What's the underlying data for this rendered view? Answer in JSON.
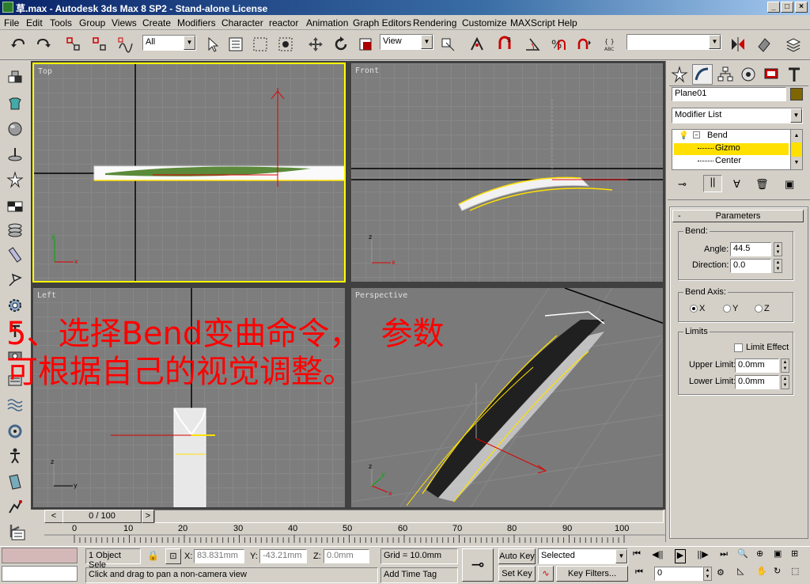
{
  "window": {
    "title": "草.max - Autodesk 3ds Max 8 SP2 - Stand-alone License",
    "min": "_",
    "max": "□",
    "close": "×"
  },
  "menu": [
    "File",
    "Edit",
    "Tools",
    "Group",
    "Views",
    "Create",
    "Modifiers",
    "Character",
    "reactor",
    "Animation",
    "Graph Editors",
    "Rendering",
    "Customize",
    "MAXScript",
    "Help"
  ],
  "toolbar": {
    "selection_filter": "All",
    "ref_coord": "View",
    "named_sel": ""
  },
  "viewports": {
    "top": "Top",
    "front": "Front",
    "left": "Left",
    "perspective": "Perspective",
    "axis_x": "x",
    "axis_y": "y",
    "axis_z": "z"
  },
  "overlay": {
    "line1": "5、选择Bend变曲命令，  参数",
    "line2": "可根据自己的视觉调整。"
  },
  "timeline": {
    "frame": "0 / 100",
    "prev": "<",
    "next": ">",
    "ticks": [
      "0",
      "10",
      "20",
      "30",
      "40",
      "50",
      "60",
      "70",
      "80",
      "90",
      "100"
    ]
  },
  "command_panel": {
    "object_name": "Plane01",
    "object_color": "#806600",
    "modifier_list": "Modifier List",
    "stack": [
      {
        "label": "Bend",
        "selected": false
      },
      {
        "label": "Gizmo",
        "selected": true
      },
      {
        "label": "Center",
        "selected": false
      }
    ],
    "rollout_title": "Parameters",
    "rollout_toggle": "-",
    "bend_group": "Bend:",
    "angle_label": "Angle:",
    "angle_value": "44.5",
    "direction_label": "Direction:",
    "direction_value": "0.0",
    "bend_axis_group": "Bend Axis:",
    "axis_x": "X",
    "axis_y": "Y",
    "axis_z": "Z",
    "selected_axis": "X",
    "limits_group": "Limits",
    "limit_effect": "Limit Effect",
    "upper_limit_label": "Upper Limit:",
    "upper_limit_value": "0.0mm",
    "lower_limit_label": "Lower Limit:",
    "lower_limit_value": "0.0mm"
  },
  "status": {
    "selection": "1 Object Sele",
    "x_label": "X:",
    "x_value": "83.831mm",
    "y_label": "Y:",
    "y_value": "-43.21mm",
    "z_label": "Z:",
    "z_value": "0.0mm",
    "grid": "Grid = 10.0mm",
    "prompt": "Click and drag to pan a non-camera view",
    "add_time_tag": "Add Time Tag",
    "auto_key": "Auto Key",
    "set_key": "Set Key",
    "key_mode": "Selected",
    "key_filters": "Key Filters...",
    "current_frame": "0"
  },
  "colors": {
    "accent_selected": "#ffe000",
    "title_gradient_start": "#0a246a",
    "overlay_text": "#ff0000",
    "viewport_bg": "#7d7d7d",
    "active_viewport_border": "#ffff00"
  }
}
